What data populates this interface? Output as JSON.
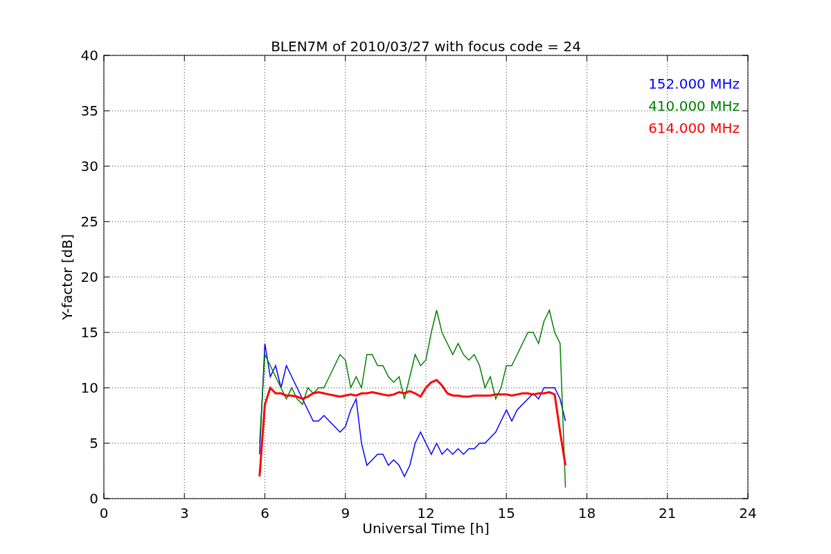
{
  "chart_data": {
    "type": "line",
    "title": "BLEN7M of 2010/03/27 with focus code = 24",
    "xlabel": "Universal Time [h]",
    "ylabel": "Y-factor [dB]",
    "x": [
      5.8,
      6.0,
      6.2,
      6.4,
      6.6,
      6.8,
      7.0,
      7.2,
      7.4,
      7.6,
      7.8,
      8.0,
      8.2,
      8.4,
      8.6,
      8.8,
      9.0,
      9.2,
      9.4,
      9.6,
      9.8,
      10.0,
      10.2,
      10.4,
      10.6,
      10.8,
      11.0,
      11.2,
      11.4,
      11.6,
      11.8,
      12.0,
      12.2,
      12.4,
      12.6,
      12.8,
      13.0,
      13.2,
      13.4,
      13.6,
      13.8,
      14.0,
      14.2,
      14.4,
      14.6,
      14.8,
      15.0,
      15.2,
      15.4,
      15.6,
      15.8,
      16.0,
      16.2,
      16.4,
      16.6,
      16.8,
      17.0,
      17.2
    ],
    "series": [
      {
        "name": "152.000 MHz",
        "color": "#0000ff",
        "values": [
          4,
          14,
          11,
          12,
          10,
          12,
          11,
          10,
          9,
          8,
          7,
          7,
          7.5,
          7,
          6.5,
          6,
          6.5,
          8,
          9,
          5,
          3,
          3.5,
          4,
          4,
          3,
          3.5,
          3,
          2,
          3,
          5,
          6,
          5,
          4,
          5,
          4,
          4.5,
          4,
          4.5,
          4,
          4.5,
          4.5,
          5,
          5,
          5.5,
          6,
          7,
          8,
          7,
          8,
          8.5,
          9,
          9.5,
          9,
          10,
          10,
          10,
          9,
          7
        ]
      },
      {
        "name": "410.000 MHz",
        "color": "#008000",
        "values": [
          5,
          13,
          12,
          11,
          10,
          9,
          10,
          9,
          8.5,
          10,
          9.5,
          10,
          10,
          11,
          12,
          13,
          12.5,
          10,
          11,
          10,
          13,
          13,
          12,
          12,
          11,
          10.5,
          11,
          9,
          11,
          13,
          12,
          12.5,
          15,
          17,
          15,
          14,
          13,
          14,
          13,
          12.5,
          13,
          12,
          10,
          11,
          9,
          10,
          12,
          12,
          13,
          14,
          15,
          15,
          14,
          16,
          17,
          15,
          14,
          1
        ]
      },
      {
        "name": "614.000 MHz",
        "color": "#ff0000",
        "values": [
          2,
          8.5,
          10,
          9.5,
          9.5,
          9.3,
          9.3,
          9.2,
          9,
          9.2,
          9.5,
          9.6,
          9.5,
          9.4,
          9.3,
          9.2,
          9.3,
          9.4,
          9.3,
          9.5,
          9.5,
          9.6,
          9.5,
          9.4,
          9.3,
          9.4,
          9.6,
          9.5,
          9.7,
          9.5,
          9.2,
          10,
          10.5,
          10.7,
          10.2,
          9.5,
          9.3,
          9.3,
          9.2,
          9.2,
          9.3,
          9.3,
          9.3,
          9.3,
          9.4,
          9.4,
          9.4,
          9.3,
          9.4,
          9.5,
          9.5,
          9.4,
          9.5,
          9.5,
          9.6,
          9.4,
          6,
          3
        ]
      }
    ],
    "xlim": [
      0,
      24
    ],
    "ylim": [
      0,
      40
    ],
    "xticks": [
      0,
      3,
      6,
      9,
      12,
      15,
      18,
      21,
      24
    ],
    "yticks": [
      0,
      5,
      10,
      15,
      20,
      25,
      30,
      35,
      40
    ],
    "grid": true
  }
}
